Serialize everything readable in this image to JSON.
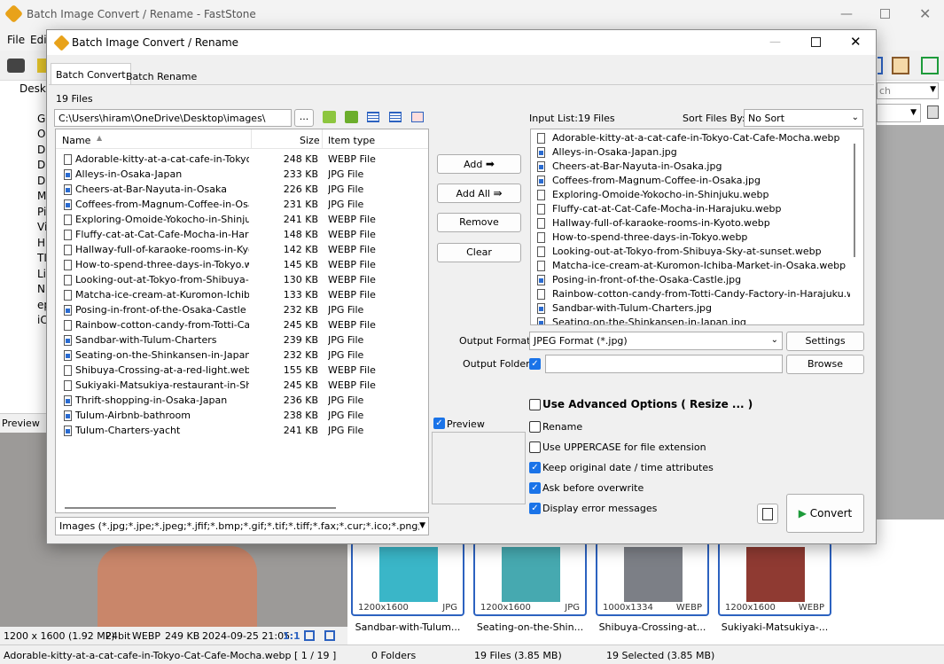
{
  "bg": {
    "title": "Batch Image Convert / Rename - FastStone",
    "menu_file": "File",
    "menu_edit": "Edi",
    "tree_items": [
      "Deskt",
      "G",
      "O",
      "D",
      "D",
      "D",
      "M",
      "Pi",
      "Vi",
      "H",
      "TI",
      "Li",
      "N",
      "ep",
      "iC"
    ],
    "preview_label": "Preview",
    "search_placeholder": "ch",
    "image_info": [
      "1200 x 1600 (1.92 MP)",
      "24bit",
      "WEBP",
      "249 KB",
      "2024-09-25 21:05",
      "1:1"
    ],
    "status": {
      "file": "Adorable-kitty-at-a-cat-cafe-in-Tokyo-Cat-Cafe-Mocha.webp [ 1 / 19 ]",
      "folders": "0 Folders",
      "files": "19 Files (3.85 MB)",
      "selected": "19 Selected (3.85 MB)"
    },
    "thumbs": [
      {
        "dims": "1200x1600",
        "ext": "JPG",
        "caption": "Sandbar-with-Tulum...",
        "color": "#3ab6c8"
      },
      {
        "dims": "1200x1600",
        "ext": "JPG",
        "caption": "Seating-on-the-Shin...",
        "color": "#46a9b0"
      },
      {
        "dims": "1000x1334",
        "ext": "WEBP",
        "caption": "Shibuya-Crossing-at...",
        "color": "#7c7f86"
      },
      {
        "dims": "1200x1600",
        "ext": "WEBP",
        "caption": "Sukiyaki-Matsukiya-...",
        "color": "#8f3a32"
      }
    ]
  },
  "dialog": {
    "title": "Batch Image Convert / Rename",
    "tabs": [
      "Batch Convert",
      "Batch Rename"
    ],
    "file_count": "19 Files",
    "path": "C:\\Users\\hiram\\OneDrive\\Desktop\\images\\",
    "browse_dots": "...",
    "columns": {
      "name": "Name",
      "size": "Size",
      "type": "Item type"
    },
    "files": [
      {
        "name": "Adorable-kitty-at-a-cat-cafe-in-Tokyo...",
        "size": "248 KB",
        "type": "WEBP File"
      },
      {
        "name": "Alleys-in-Osaka-Japan",
        "size": "233 KB",
        "type": "JPG File"
      },
      {
        "name": "Cheers-at-Bar-Nayuta-in-Osaka",
        "size": "226 KB",
        "type": "JPG File"
      },
      {
        "name": "Coffees-from-Magnum-Coffee-in-Osaka",
        "size": "231 KB",
        "type": "JPG File"
      },
      {
        "name": "Exploring-Omoide-Yokocho-in-Shinjuku...",
        "size": "241 KB",
        "type": "WEBP File"
      },
      {
        "name": "Fluffy-cat-at-Cat-Cafe-Mocha-in-Hara...",
        "size": "148 KB",
        "type": "WEBP File"
      },
      {
        "name": "Hallway-full-of-karaoke-rooms-in-Kyot...",
        "size": "142 KB",
        "type": "WEBP File"
      },
      {
        "name": "How-to-spend-three-days-in-Tokyo.w...",
        "size": "145 KB",
        "type": "WEBP File"
      },
      {
        "name": "Looking-out-at-Tokyo-from-Shibuya-S...",
        "size": "130 KB",
        "type": "WEBP File"
      },
      {
        "name": "Matcha-ice-cream-at-Kuromon-Ichiba-...",
        "size": "133 KB",
        "type": "WEBP File"
      },
      {
        "name": "Posing-in-front-of-the-Osaka-Castle",
        "size": "232 KB",
        "type": "JPG File"
      },
      {
        "name": "Rainbow-cotton-candy-from-Totti-Can...",
        "size": "245 KB",
        "type": "WEBP File"
      },
      {
        "name": "Sandbar-with-Tulum-Charters",
        "size": "239 KB",
        "type": "JPG File"
      },
      {
        "name": "Seating-on-the-Shinkansen-in-Japan",
        "size": "232 KB",
        "type": "JPG File"
      },
      {
        "name": "Shibuya-Crossing-at-a-red-light.webp",
        "size": "155 KB",
        "type": "WEBP File"
      },
      {
        "name": "Sukiyaki-Matsukiya-restaurant-in-Shib...",
        "size": "245 KB",
        "type": "WEBP File"
      },
      {
        "name": "Thrift-shopping-in-Osaka-Japan",
        "size": "236 KB",
        "type": "JPG File"
      },
      {
        "name": "Tulum-Airbnb-bathroom",
        "size": "238 KB",
        "type": "JPG File"
      },
      {
        "name": "Tulum-Charters-yacht",
        "size": "241 KB",
        "type": "JPG File"
      }
    ],
    "filter": "Images (*.jpg;*.jpe;*.jpeg;*.jfif;*.bmp;*.gif;*.tif;*.tiff;*.fax;*.cur;*.ico;*.png;*",
    "buttons": {
      "add": "Add",
      "add_all": "Add All",
      "remove": "Remove",
      "clear": "Clear"
    },
    "preview_label": "Preview",
    "input_list_label": "Input List:",
    "input_count": "19 Files",
    "sort_label": "Sort Files By:",
    "sort_value": "No Sort",
    "input_files": [
      {
        "name": "Adorable-kitty-at-a-cat-cafe-in-Tokyo-Cat-Cafe-Mocha.webp",
        "jpg": false
      },
      {
        "name": "Alleys-in-Osaka-Japan.jpg",
        "jpg": true
      },
      {
        "name": "Cheers-at-Bar-Nayuta-in-Osaka.jpg",
        "jpg": true
      },
      {
        "name": "Coffees-from-Magnum-Coffee-in-Osaka.jpg",
        "jpg": true
      },
      {
        "name": "Exploring-Omoide-Yokocho-in-Shinjuku.webp",
        "jpg": false
      },
      {
        "name": "Fluffy-cat-at-Cat-Cafe-Mocha-in-Harajuku.webp",
        "jpg": false
      },
      {
        "name": "Hallway-full-of-karaoke-rooms-in-Kyoto.webp",
        "jpg": false
      },
      {
        "name": "How-to-spend-three-days-in-Tokyo.webp",
        "jpg": false
      },
      {
        "name": "Looking-out-at-Tokyo-from-Shibuya-Sky-at-sunset.webp",
        "jpg": false
      },
      {
        "name": "Matcha-ice-cream-at-Kuromon-Ichiba-Market-in-Osaka.webp",
        "jpg": false
      },
      {
        "name": "Posing-in-front-of-the-Osaka-Castle.jpg",
        "jpg": true
      },
      {
        "name": "Rainbow-cotton-candy-from-Totti-Candy-Factory-in-Harajuku.webp",
        "jpg": false
      },
      {
        "name": "Sandbar-with-Tulum-Charters.jpg",
        "jpg": true
      },
      {
        "name": "Seating-on-the-Shinkansen-in-Japan.jpg",
        "jpg": true
      }
    ],
    "output_format_label": "Output Format:",
    "output_format": "JPEG Format (*.jpg)",
    "settings": "Settings",
    "output_folder_label": "Output Folder:",
    "output_folder": "",
    "browse": "Browse",
    "options": {
      "advanced": "Use Advanced Options ( Resize ... )",
      "rename": "Rename",
      "uppercase": "Use UPPERCASE for file extension",
      "keep_date": "Keep original date / time attributes",
      "ask_overwrite": "Ask before overwrite",
      "display_errors": "Display error messages"
    },
    "convert": "Convert"
  }
}
